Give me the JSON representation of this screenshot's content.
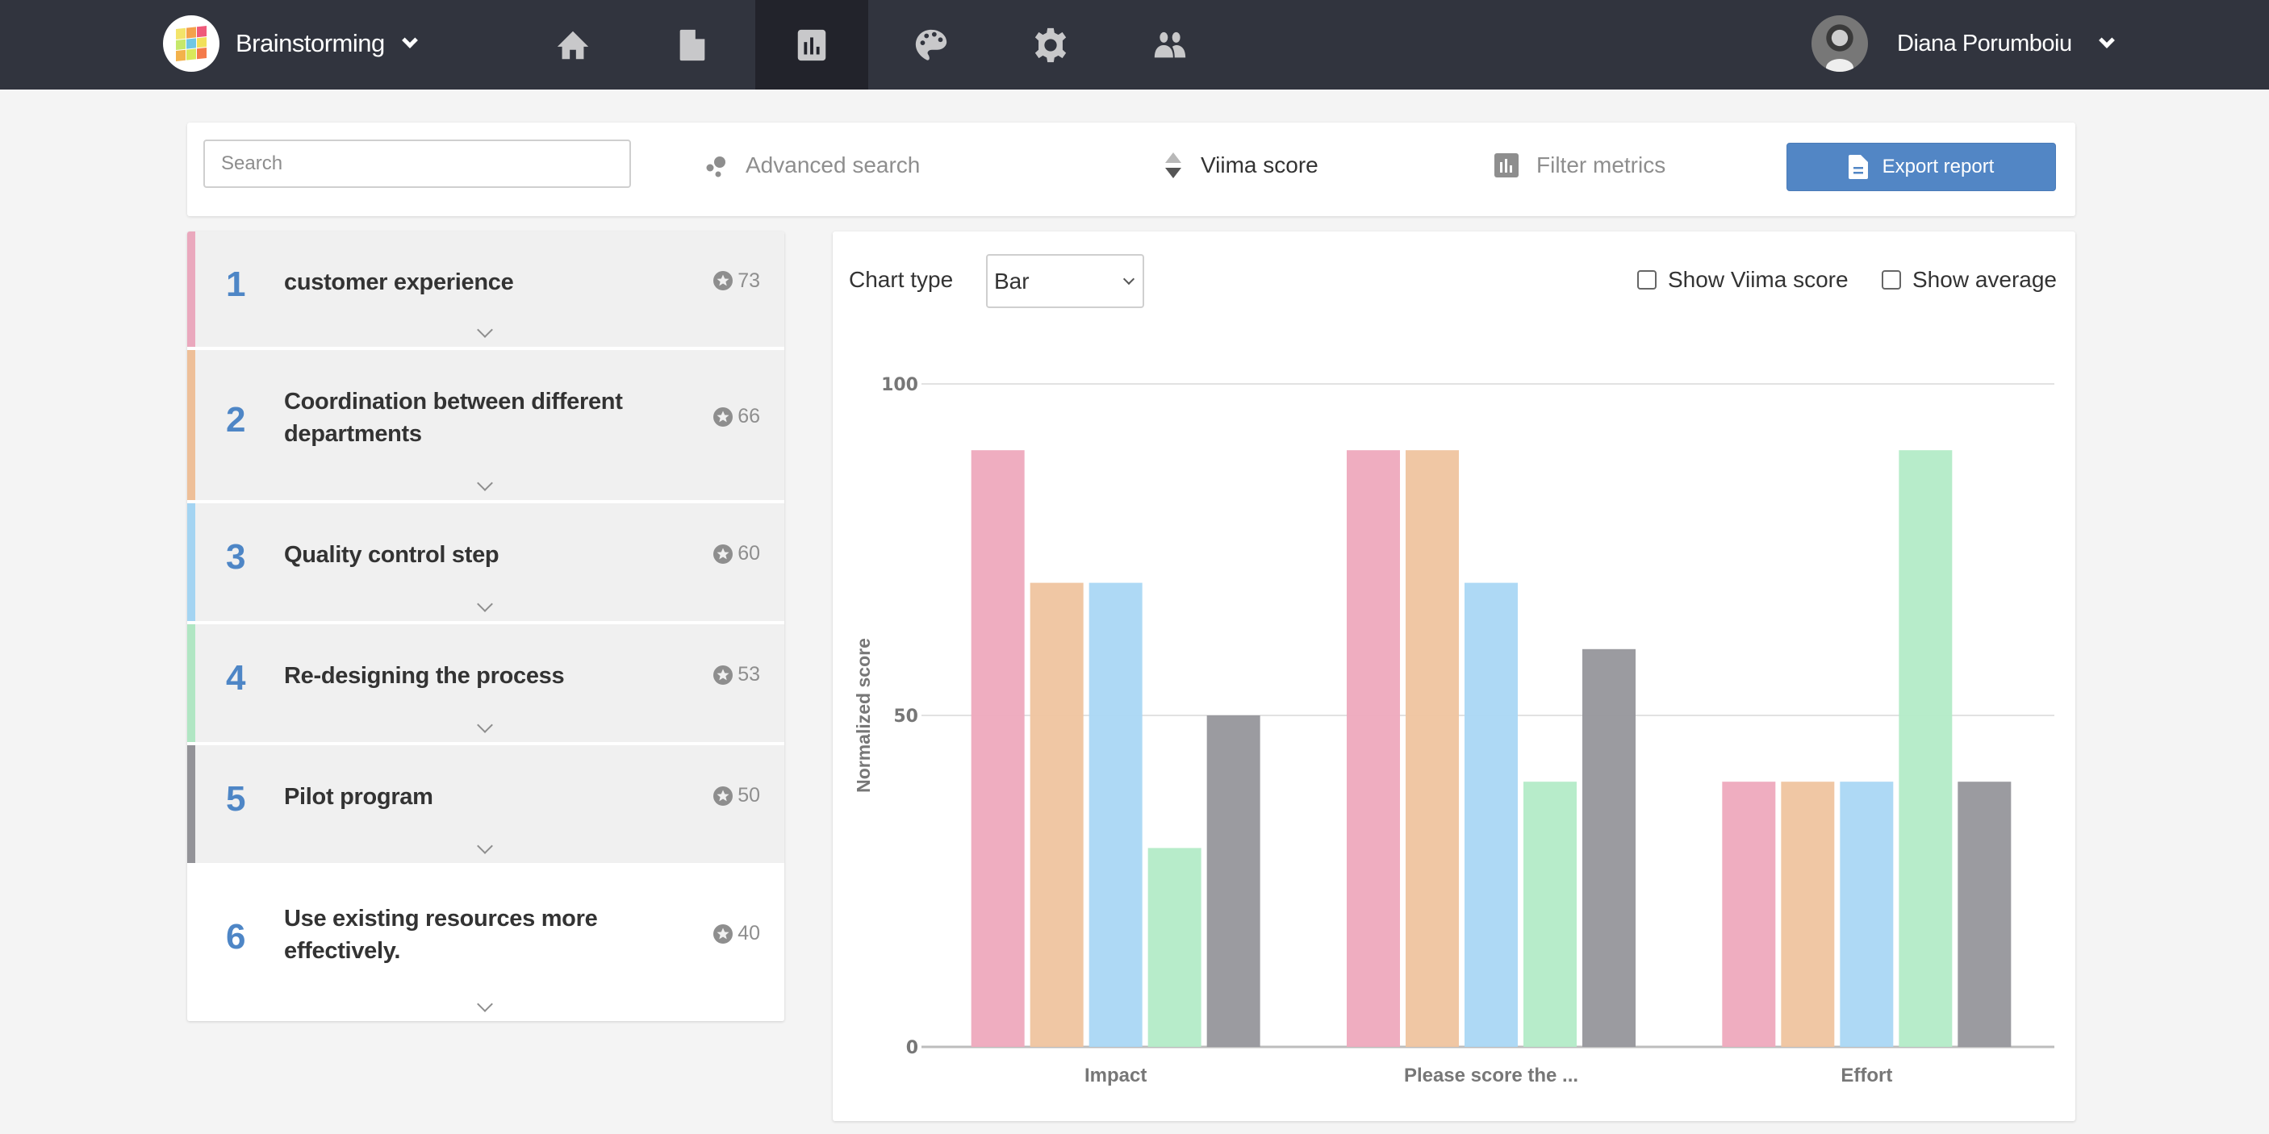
{
  "nav": {
    "workspace": "Brainstorming",
    "icons": [
      "home-icon",
      "document-icon",
      "chart-icon",
      "palette-icon",
      "gear-icon",
      "users-icon"
    ],
    "active_icon": "chart-icon",
    "user_name": "Diana Porumboiu"
  },
  "toolbar": {
    "search_placeholder": "Search",
    "search_value": "",
    "advanced_search": "Advanced search",
    "sort": "Viima score",
    "filter_metrics": "Filter metrics",
    "export_report": "Export report"
  },
  "ideas": [
    {
      "rank": "1",
      "title": "customer experience",
      "score": "73",
      "color": "#eaa8bd",
      "highlighted": true
    },
    {
      "rank": "2",
      "title": "Coordination between different departments",
      "score": "66",
      "color": "#eebf98",
      "highlighted": true
    },
    {
      "rank": "3",
      "title": "Quality control step",
      "score": "60",
      "color": "#a4d4f2",
      "highlighted": true
    },
    {
      "rank": "4",
      "title": "Re-designing the process",
      "score": "53",
      "color": "#b0e6c3",
      "highlighted": true
    },
    {
      "rank": "5",
      "title": "Pilot program",
      "score": "50",
      "color": "#939398",
      "highlighted": true
    },
    {
      "rank": "6",
      "title": "Use existing resources more effectively.",
      "score": "40",
      "color": null,
      "highlighted": false
    }
  ],
  "chart_controls": {
    "chart_type_label": "Chart type",
    "chart_type_value": "Bar",
    "show_viima_score": "Show Viima score",
    "show_viima_score_checked": false,
    "show_average": "Show average",
    "show_average_checked": false
  },
  "chart_data": {
    "type": "bar",
    "title": "",
    "xlabel": "",
    "ylabel": "Normalized score",
    "ylim": [
      0,
      100
    ],
    "yticks": [
      0,
      50,
      100
    ],
    "grid": true,
    "legend": "none",
    "categories": [
      "Impact",
      "Please score the ...",
      "Effort"
    ],
    "series": [
      {
        "name": "customer experience",
        "color": "#eeaabe",
        "values": [
          90,
          90,
          40
        ]
      },
      {
        "name": "Coordination between different departments",
        "color": "#efc5a1",
        "values": [
          70,
          90,
          40
        ]
      },
      {
        "name": "Quality control step",
        "color": "#abd8f5",
        "values": [
          70,
          70,
          40
        ]
      },
      {
        "name": "Re-designing the process",
        "color": "#b5ebc8",
        "values": [
          30,
          40,
          90
        ]
      },
      {
        "name": "Pilot program",
        "color": "#98989d",
        "values": [
          50,
          60,
          40
        ]
      }
    ]
  }
}
